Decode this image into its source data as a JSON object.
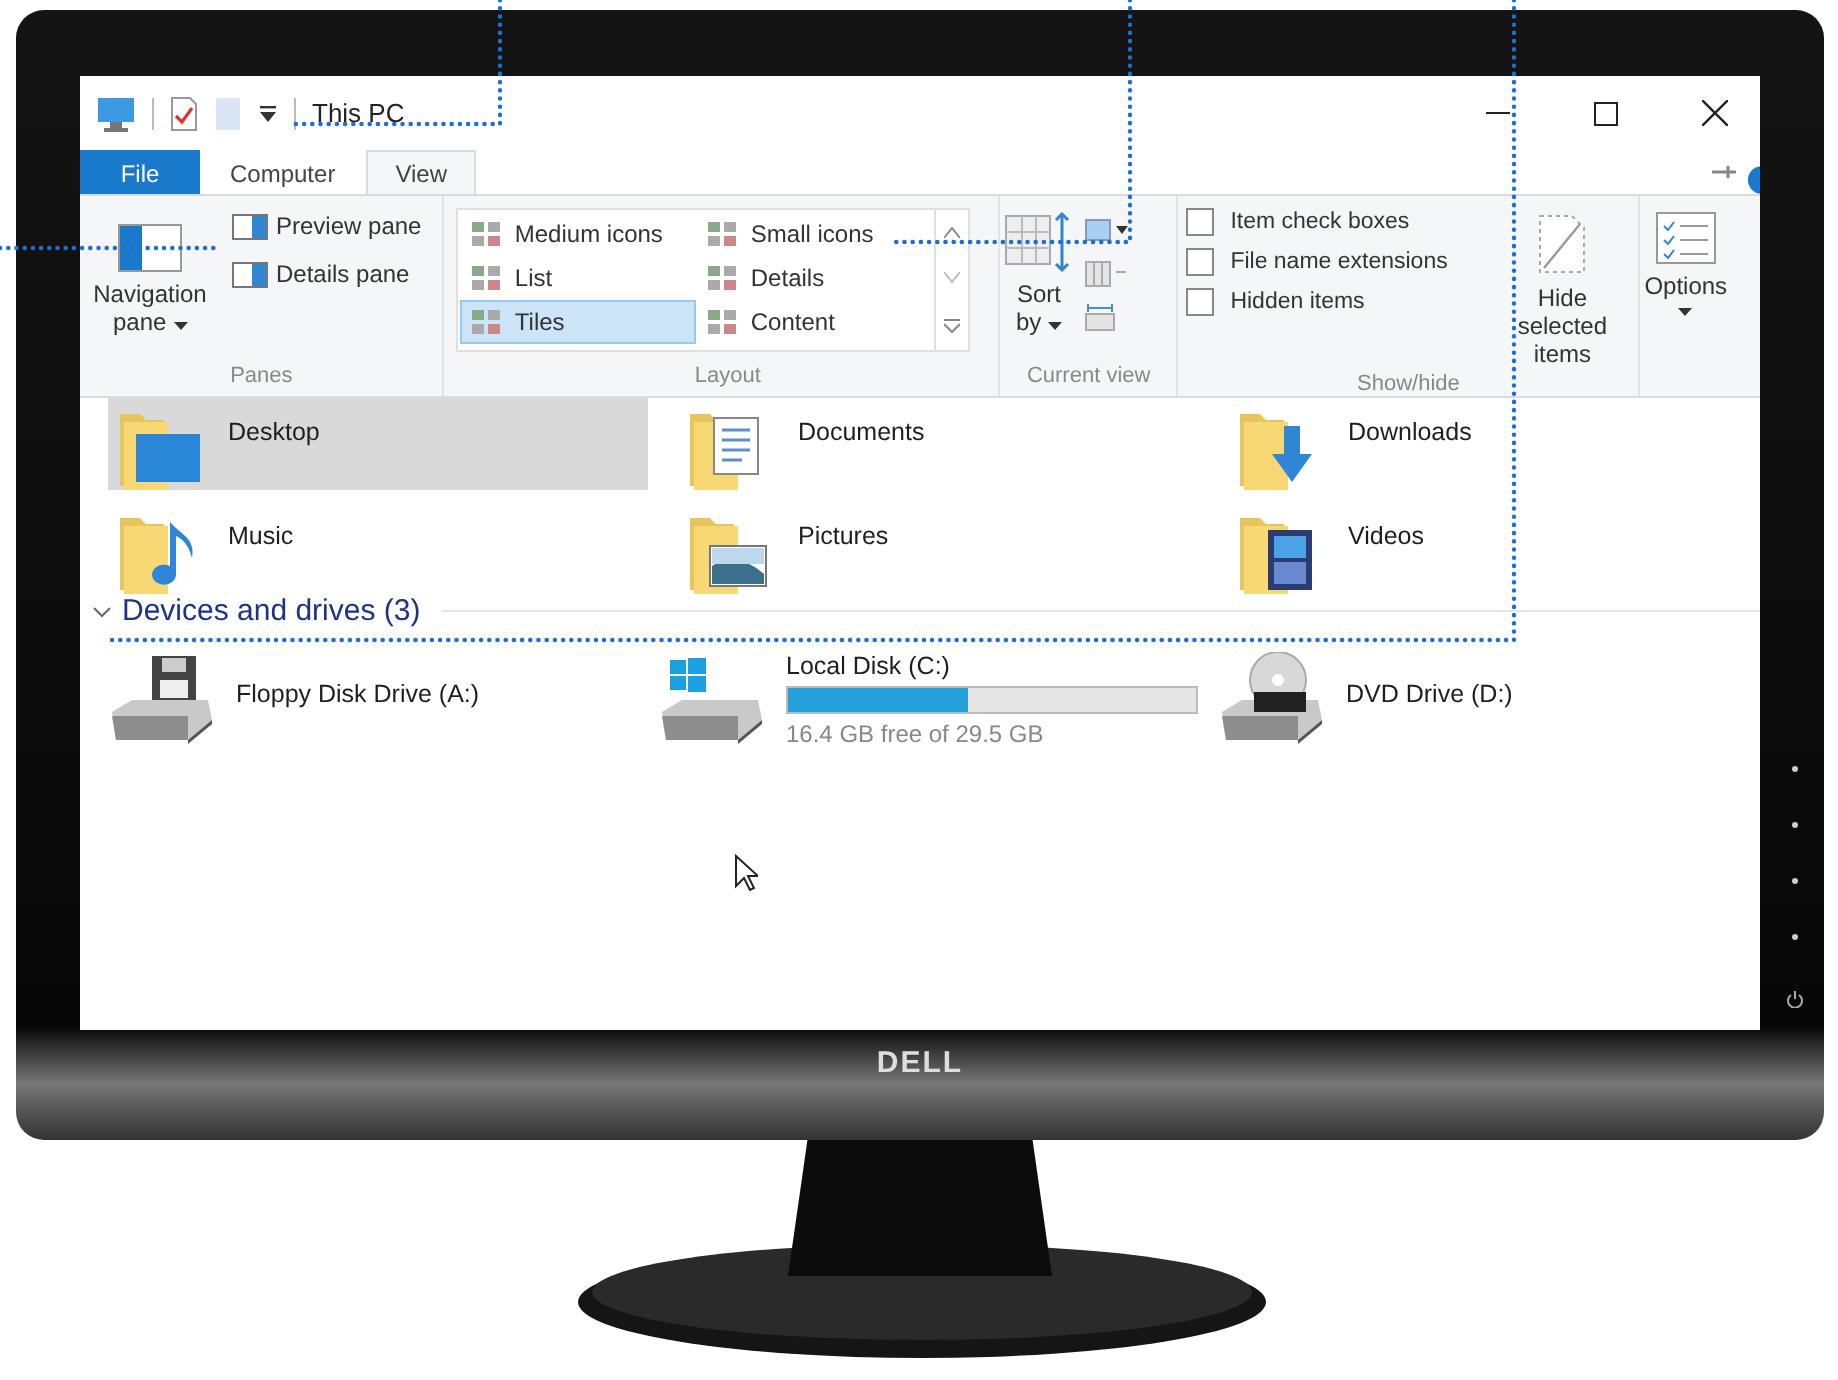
{
  "window": {
    "title": "This PC"
  },
  "tabs": [
    {
      "label": "File",
      "kind": "file",
      "selected": false
    },
    {
      "label": "Computer",
      "kind": "tab",
      "selected": false
    },
    {
      "label": "View",
      "kind": "tab",
      "selected": true
    }
  ],
  "ribbon": {
    "panes": {
      "label": "Panes",
      "navigation_pane": "Navigation pane",
      "items": [
        "Preview pane",
        "Details pane"
      ]
    },
    "layout": {
      "label": "Layout",
      "options": [
        {
          "label": "Medium icons",
          "selected": false
        },
        {
          "label": "Small icons",
          "selected": false
        },
        {
          "label": "List",
          "selected": false
        },
        {
          "label": "Details",
          "selected": false
        },
        {
          "label": "Tiles",
          "selected": true
        },
        {
          "label": "Content",
          "selected": false
        }
      ]
    },
    "current_view": {
      "label": "Current view",
      "sort_by": "Sort by"
    },
    "show_hide": {
      "label": "Show/hide",
      "checkboxes": [
        {
          "label": "Item check boxes",
          "checked": false
        },
        {
          "label": "File name extensions",
          "checked": false
        },
        {
          "label": "Hidden items",
          "checked": false
        }
      ],
      "hide_selected": "Hide selected items"
    },
    "options": "Options"
  },
  "folders": [
    {
      "name": "Desktop",
      "kind": "desktop",
      "selected": true
    },
    {
      "name": "Documents",
      "kind": "documents",
      "selected": false
    },
    {
      "name": "Downloads",
      "kind": "downloads",
      "selected": false
    },
    {
      "name": "Music",
      "kind": "music",
      "selected": false
    },
    {
      "name": "Pictures",
      "kind": "pictures",
      "selected": false
    },
    {
      "name": "Videos",
      "kind": "videos",
      "selected": false
    }
  ],
  "section": {
    "title": "Devices and drives (3)",
    "expanded": true
  },
  "drives": [
    {
      "name": "Floppy Disk Drive (A:)",
      "kind": "floppy"
    },
    {
      "name": "Local Disk (C:)",
      "kind": "disk",
      "level": 0.44,
      "free": "16.4 GB free of 29.5 GB"
    },
    {
      "name": "DVD Drive (D:)",
      "kind": "dvd"
    }
  ],
  "monitor": {
    "brand": "DELL"
  }
}
